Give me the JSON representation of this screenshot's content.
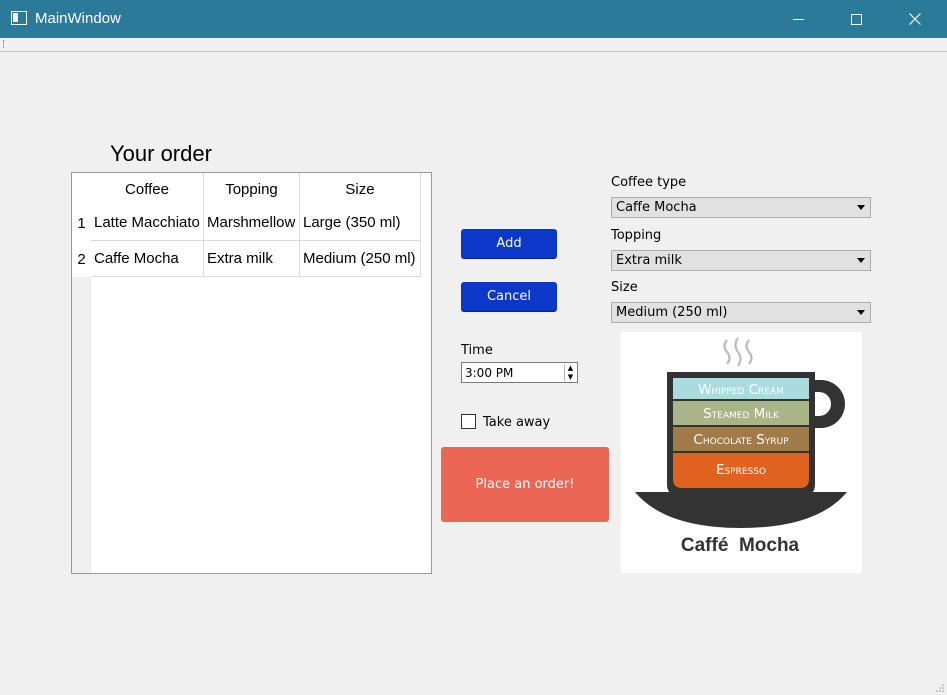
{
  "window": {
    "title": "MainWindow"
  },
  "order": {
    "heading": "Your order",
    "columns": [
      "Coffee",
      "Topping",
      "Size"
    ],
    "rows": [
      {
        "num": "1",
        "coffee": "Latte Macchiato",
        "topping": "Marshmellow",
        "size": "Large (350 ml)"
      },
      {
        "num": "2",
        "coffee": "Caffe Mocha",
        "topping": "Extra milk",
        "size": "Medium (250 ml)"
      }
    ]
  },
  "actions": {
    "add_label": "Add",
    "cancel_label": "Cancel",
    "place_order_label": "Place an order!"
  },
  "time": {
    "label": "Time",
    "value": "3:00 PM"
  },
  "take_away": {
    "label": "Take away",
    "checked": false
  },
  "selectors": {
    "coffee_type": {
      "label": "Coffee type",
      "value": "Caffe Mocha"
    },
    "topping": {
      "label": "Topping",
      "value": "Extra milk"
    },
    "size": {
      "label": "Size",
      "value": "Medium (250 ml)"
    }
  },
  "illustration": {
    "layers": [
      "Whipped Cream",
      "Steamed Milk",
      "Chocolate Syrup",
      "Espresso"
    ],
    "caption": "Caffé  Mocha"
  },
  "colors": {
    "titlebar": "#2c7a99",
    "button_blue": "#0b38c8",
    "order_button": "#ec6655",
    "whipped_cream": "#a9dcdf",
    "steamed_milk": "#a9b487",
    "chocolate_syrup": "#a07a48",
    "espresso": "#e0621e",
    "cup": "#333333"
  }
}
